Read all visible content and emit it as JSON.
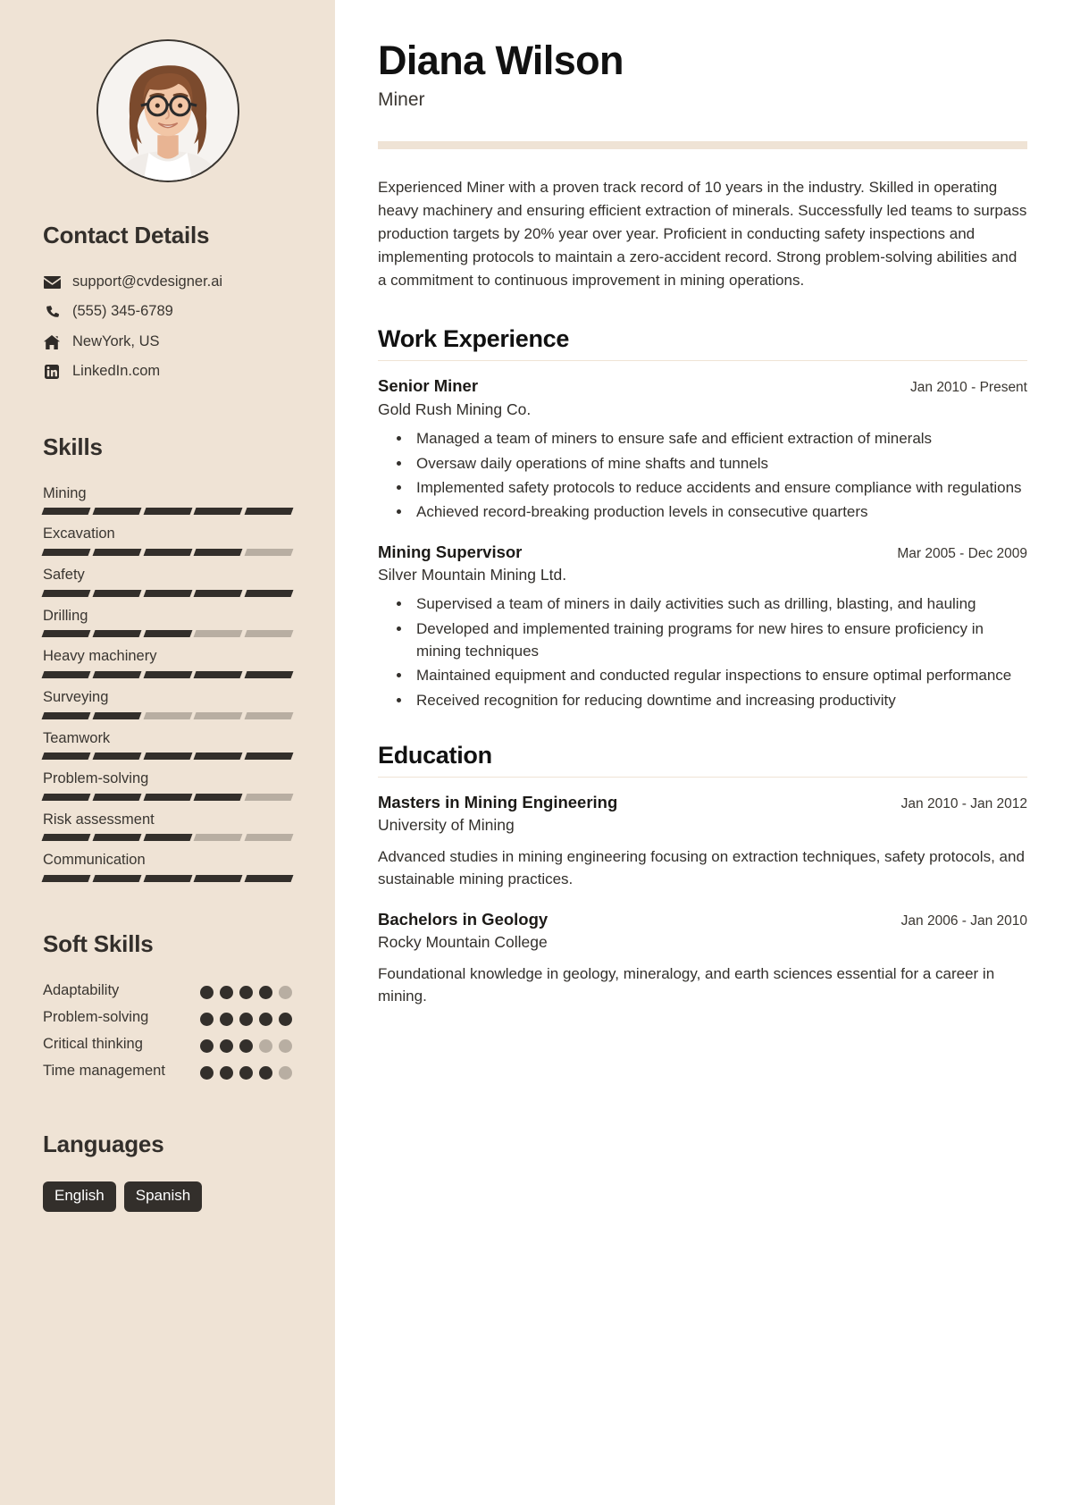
{
  "sidebar": {
    "avatar_alt": "profile-photo",
    "contact": {
      "heading": "Contact Details",
      "items": [
        {
          "icon": "email-icon",
          "text": "support@cvdesigner.ai"
        },
        {
          "icon": "phone-icon",
          "text": "(555) 345-6789"
        },
        {
          "icon": "home-icon",
          "text": "NewYork, US"
        },
        {
          "icon": "linkedin-icon",
          "text": "LinkedIn.com"
        }
      ]
    },
    "skills": {
      "heading": "Skills",
      "max": 5,
      "items": [
        {
          "name": "Mining",
          "level": 5
        },
        {
          "name": "Excavation",
          "level": 4
        },
        {
          "name": "Safety",
          "level": 5
        },
        {
          "name": "Drilling",
          "level": 3
        },
        {
          "name": "Heavy machinery",
          "level": 5
        },
        {
          "name": "Surveying",
          "level": 2
        },
        {
          "name": "Teamwork",
          "level": 5
        },
        {
          "name": "Problem-solving",
          "level": 4
        },
        {
          "name": "Risk assessment",
          "level": 3
        },
        {
          "name": "Communication",
          "level": 5
        }
      ]
    },
    "soft_skills": {
      "heading": "Soft Skills",
      "max": 5,
      "items": [
        {
          "name": "Adaptability",
          "level": 4
        },
        {
          "name": "Problem-solving",
          "level": 5
        },
        {
          "name": "Critical thinking",
          "level": 3
        },
        {
          "name": "Time management",
          "level": 4
        }
      ]
    },
    "languages": {
      "heading": "Languages",
      "items": [
        "English",
        "Spanish"
      ]
    }
  },
  "main": {
    "name": "Diana Wilson",
    "job_title": "Miner",
    "summary": "Experienced Miner with a proven track record of 10 years in the industry. Skilled in operating heavy machinery and ensuring efficient extraction of minerals. Successfully led teams to surpass production targets by 20% year over year. Proficient in conducting safety inspections and implementing protocols to maintain a zero-accident record. Strong problem-solving abilities and a commitment to continuous improvement in mining operations.",
    "work_experience": {
      "heading": "Work Experience",
      "entries": [
        {
          "role": "Senior Miner",
          "organization": "Gold Rush Mining Co.",
          "date": "Jan 2010 - Present",
          "bullets": [
            "Managed a team of miners to ensure safe and efficient extraction of minerals",
            "Oversaw daily operations of mine shafts and tunnels",
            "Implemented safety protocols to reduce accidents and ensure compliance with regulations",
            "Achieved record-breaking production levels in consecutive quarters"
          ]
        },
        {
          "role": "Mining Supervisor",
          "organization": "Silver Mountain Mining Ltd.",
          "date": "Mar 2005 - Dec 2009",
          "bullets": [
            "Supervised a team of miners in daily activities such as drilling, blasting, and hauling",
            "Developed and implemented training programs for new hires to ensure proficiency in mining techniques",
            "Maintained equipment and conducted regular inspections to ensure optimal performance",
            "Received recognition for reducing downtime and increasing productivity"
          ]
        }
      ]
    },
    "education": {
      "heading": "Education",
      "entries": [
        {
          "degree": "Masters in Mining Engineering",
          "institution": "University of Mining",
          "date": "Jan 2010 - Jan 2012",
          "description": "Advanced studies in mining engineering focusing on extraction techniques, safety protocols, and sustainable mining practices."
        },
        {
          "degree": "Bachelors in Geology",
          "institution": "Rocky Mountain College",
          "date": "Jan 2006 - Jan 2010",
          "description": "Foundational knowledge in geology, mineralogy, and earth sciences essential for a career in mining."
        }
      ]
    }
  },
  "colors": {
    "sidebar_bg": "#EFE3D5",
    "ink": "#332f2b",
    "muted": "#b8aea2",
    "page_bg": "#ffffff"
  }
}
